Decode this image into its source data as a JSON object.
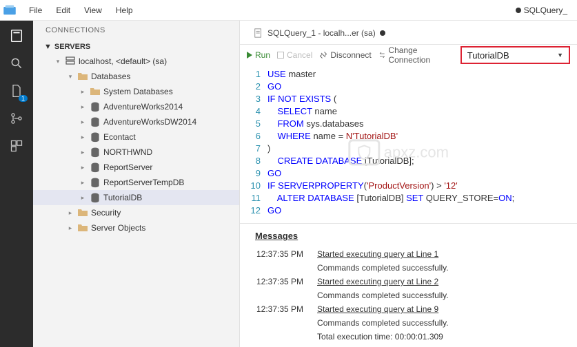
{
  "menubar": {
    "items": [
      "File",
      "Edit",
      "View",
      "Help"
    ],
    "rightFile": "SQLQuery_"
  },
  "sidebar": {
    "title": "CONNECTIONS",
    "section": "SERVERS",
    "server": "localhost, <default> (sa)",
    "databasesLabel": "Databases",
    "databases": [
      "System Databases",
      "AdventureWorks2014",
      "AdventureWorksDW2014",
      "Econtact",
      "NORTHWND",
      "ReportServer",
      "ReportServerTempDB",
      "TutorialDB"
    ],
    "folders": [
      "Security",
      "Server Objects"
    ]
  },
  "editor": {
    "tabLabel": "SQLQuery_1 - localh...er (sa)",
    "toolbar": {
      "run": "Run",
      "cancel": "Cancel",
      "disconnect": "Disconnect",
      "change": "Change Connection",
      "database": "TutorialDB"
    },
    "code": {
      "lines": [
        1,
        2,
        3,
        4,
        5,
        6,
        7,
        8,
        9,
        10,
        11,
        12
      ],
      "l1": "USE",
      "l1b": " master",
      "l2": "GO",
      "l3": "IF NOT EXISTS",
      "l3b": " (",
      "l4": "SELECT",
      "l4b": " name",
      "l5": "FROM",
      "l5b": " sys.databases",
      "l6": "WHERE",
      "l6b": " name = ",
      "l6s": "N'TutorialDB'",
      "l7": ")",
      "l8": "CREATE DATABASE",
      "l8b": " [TutorialDB];",
      "l9": "GO",
      "l10": "IF SERVERPROPERTY",
      "l10b": "(",
      "l10s": "'ProductVersion'",
      "l10c": ") > ",
      "l10d": "'12'",
      "l11": "ALTER DATABASE",
      "l11b": " [TutorialDB] ",
      "l11c": "SET",
      "l11d": " QUERY_STORE=",
      "l11e": "ON",
      ";": ";",
      "l12": "GO"
    }
  },
  "messages": {
    "title": "Messages",
    "rows": [
      {
        "t": "12:37:35 PM",
        "a": "Started executing query at Line 1",
        "b": "Commands completed successfully."
      },
      {
        "t": "12:37:35 PM",
        "a": "Started executing query at Line 2",
        "b": "Commands completed successfully."
      },
      {
        "t": "12:37:35 PM",
        "a": "Started executing query at Line 9",
        "b": "Commands completed successfully."
      }
    ],
    "total": "Total execution time: 00:00:01.309"
  },
  "watermark": "apxz.com"
}
